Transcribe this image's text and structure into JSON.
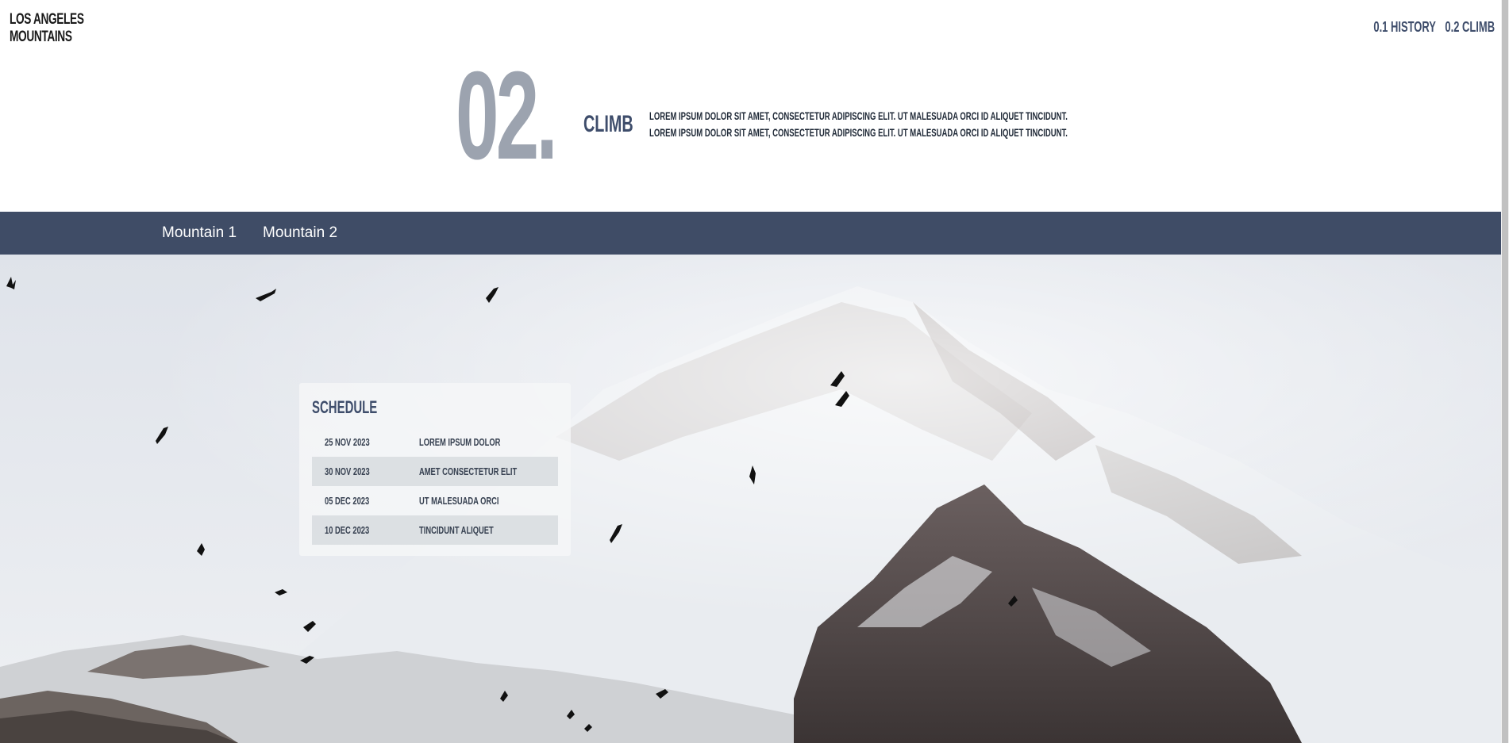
{
  "header": {
    "logo_line1": "LOS ANGELES",
    "logo_line2": "MOUNTAINS",
    "nav": [
      "0.1 HISTORY",
      "0.2 CLIMB"
    ]
  },
  "hero": {
    "number": "02.",
    "label": "CLIMB",
    "text_line1": "LOREM IPSUM DOLOR SIT AMET, CONSECTETUR ADIPISCING ELIT. UT MALESUADA ORCI ID ALIQUET TINCIDUNT.",
    "text_line2": "LOREM IPSUM DOLOR SIT AMET, CONSECTETUR ADIPISCING ELIT. UT MALESUADA ORCI ID ALIQUET TINCIDUNT."
  },
  "tabs": [
    "Mountain 1",
    "Mountain 2"
  ],
  "schedule": {
    "title": "SCHEDULE",
    "rows": [
      {
        "date": "25 NOV 2023",
        "event": "LOREM IPSUM DOLOR"
      },
      {
        "date": "30 NOV 2023",
        "event": "AMET CONSECTETUR ELIT"
      },
      {
        "date": "05 DEC 2023",
        "event": "UT MALESUADA ORCI"
      },
      {
        "date": "10 DEC 2023",
        "event": "TINCIDUNT ALIQUET"
      }
    ]
  },
  "colors": {
    "accent": "#3f4c66",
    "hero_number": "#9ca3af",
    "label": "#3e4d6b"
  },
  "image": {
    "description_icon": "mountain-photo"
  }
}
